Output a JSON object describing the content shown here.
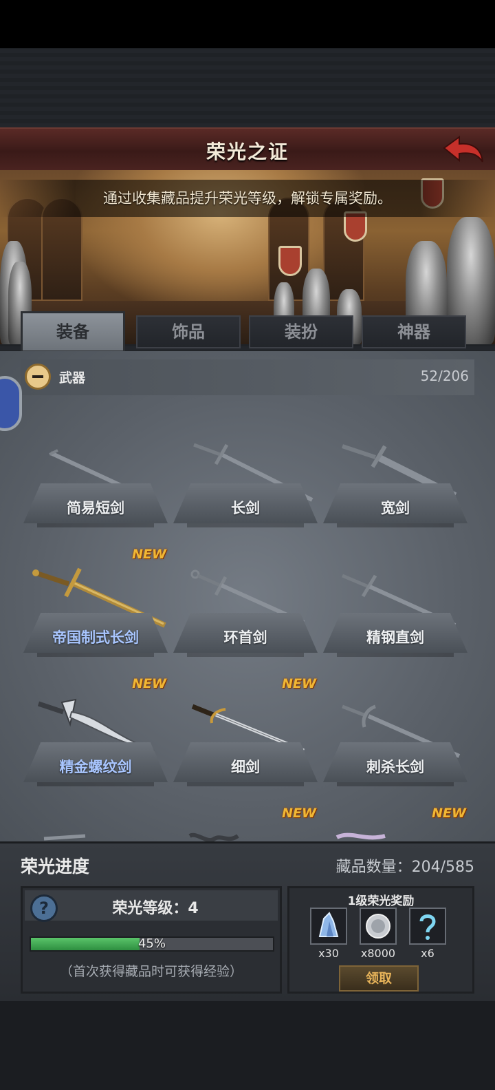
{
  "header": {
    "title": "荣光之证"
  },
  "banner": {
    "caption": "通过收集藏品提升荣光等级，解锁专属奖励。"
  },
  "tabs": [
    {
      "label": "装备",
      "active": true
    },
    {
      "label": "饰品",
      "active": false
    },
    {
      "label": "装扮",
      "active": false
    },
    {
      "label": "神器",
      "active": false
    }
  ],
  "category": {
    "label": "武器",
    "count": "52/206"
  },
  "items": [
    {
      "name": "简易短剑",
      "new": "",
      "owned": false,
      "icon": "short-sword-icon"
    },
    {
      "name": "长剑",
      "new": "",
      "owned": false,
      "icon": "long-sword-icon"
    },
    {
      "name": "宽剑",
      "new": "",
      "owned": false,
      "icon": "broad-sword-icon"
    },
    {
      "name": "帝国制式长剑",
      "new": "NEW",
      "owned": true,
      "icon": "imperial-sword-icon"
    },
    {
      "name": "环首剑",
      "new": "",
      "owned": false,
      "icon": "ring-sword-icon"
    },
    {
      "name": "精钢直剑",
      "new": "",
      "owned": false,
      "icon": "steel-sword-icon"
    },
    {
      "name": "精金螺纹剑",
      "new": "NEW",
      "owned": true,
      "icon": "spiral-sword-icon"
    },
    {
      "name": "细剑",
      "new": "NEW",
      "owned": true,
      "icon": "rapier-icon"
    },
    {
      "name": "刺杀长剑",
      "new": "",
      "owned": false,
      "icon": "assassin-sword-icon"
    }
  ],
  "partial_row_new": [
    "NEW",
    "NEW"
  ],
  "progress": {
    "label": "荣光进度",
    "collection_count": "藏品数量：204/585",
    "level_text": "荣光等级：4",
    "percent": 45,
    "percent_text": "45%",
    "hint": "（首次获得藏品时可获得经验）"
  },
  "rewards": {
    "title": "1级荣光奖励",
    "items": [
      {
        "icon": "crystal-icon",
        "qty": "x30"
      },
      {
        "icon": "silver-coin-icon",
        "qty": "x8000"
      },
      {
        "icon": "question-rune-icon",
        "qty": "x6"
      }
    ],
    "claim_label": "领取"
  },
  "colors": {
    "accent_gold": "#f0b735",
    "progress_green": "#3da34e",
    "owned_blue": "#a9c6ff"
  }
}
